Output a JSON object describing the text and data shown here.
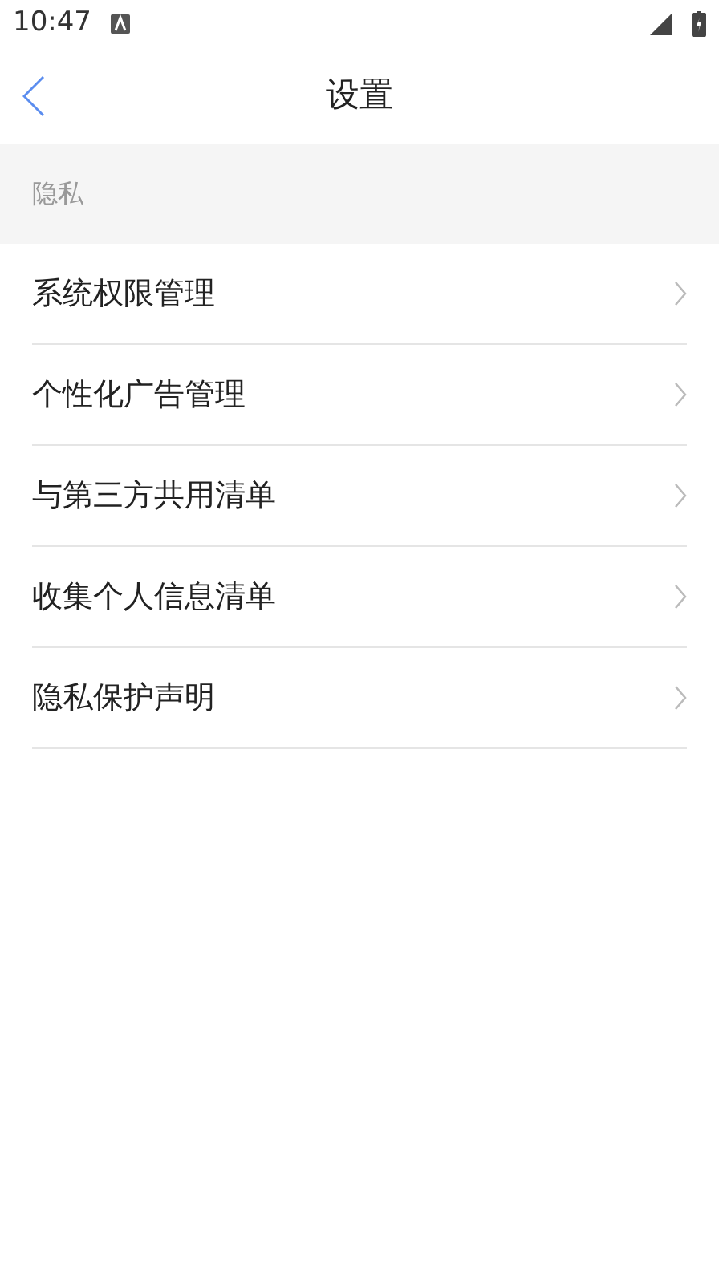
{
  "status_bar": {
    "time": "10:47"
  },
  "header": {
    "title": "设置"
  },
  "section": {
    "title": "隐私"
  },
  "items": [
    {
      "label": "系统权限管理"
    },
    {
      "label": "个性化广告管理"
    },
    {
      "label": "与第三方共用清单"
    },
    {
      "label": "收集个人信息清单"
    },
    {
      "label": "隐私保护声明"
    }
  ]
}
